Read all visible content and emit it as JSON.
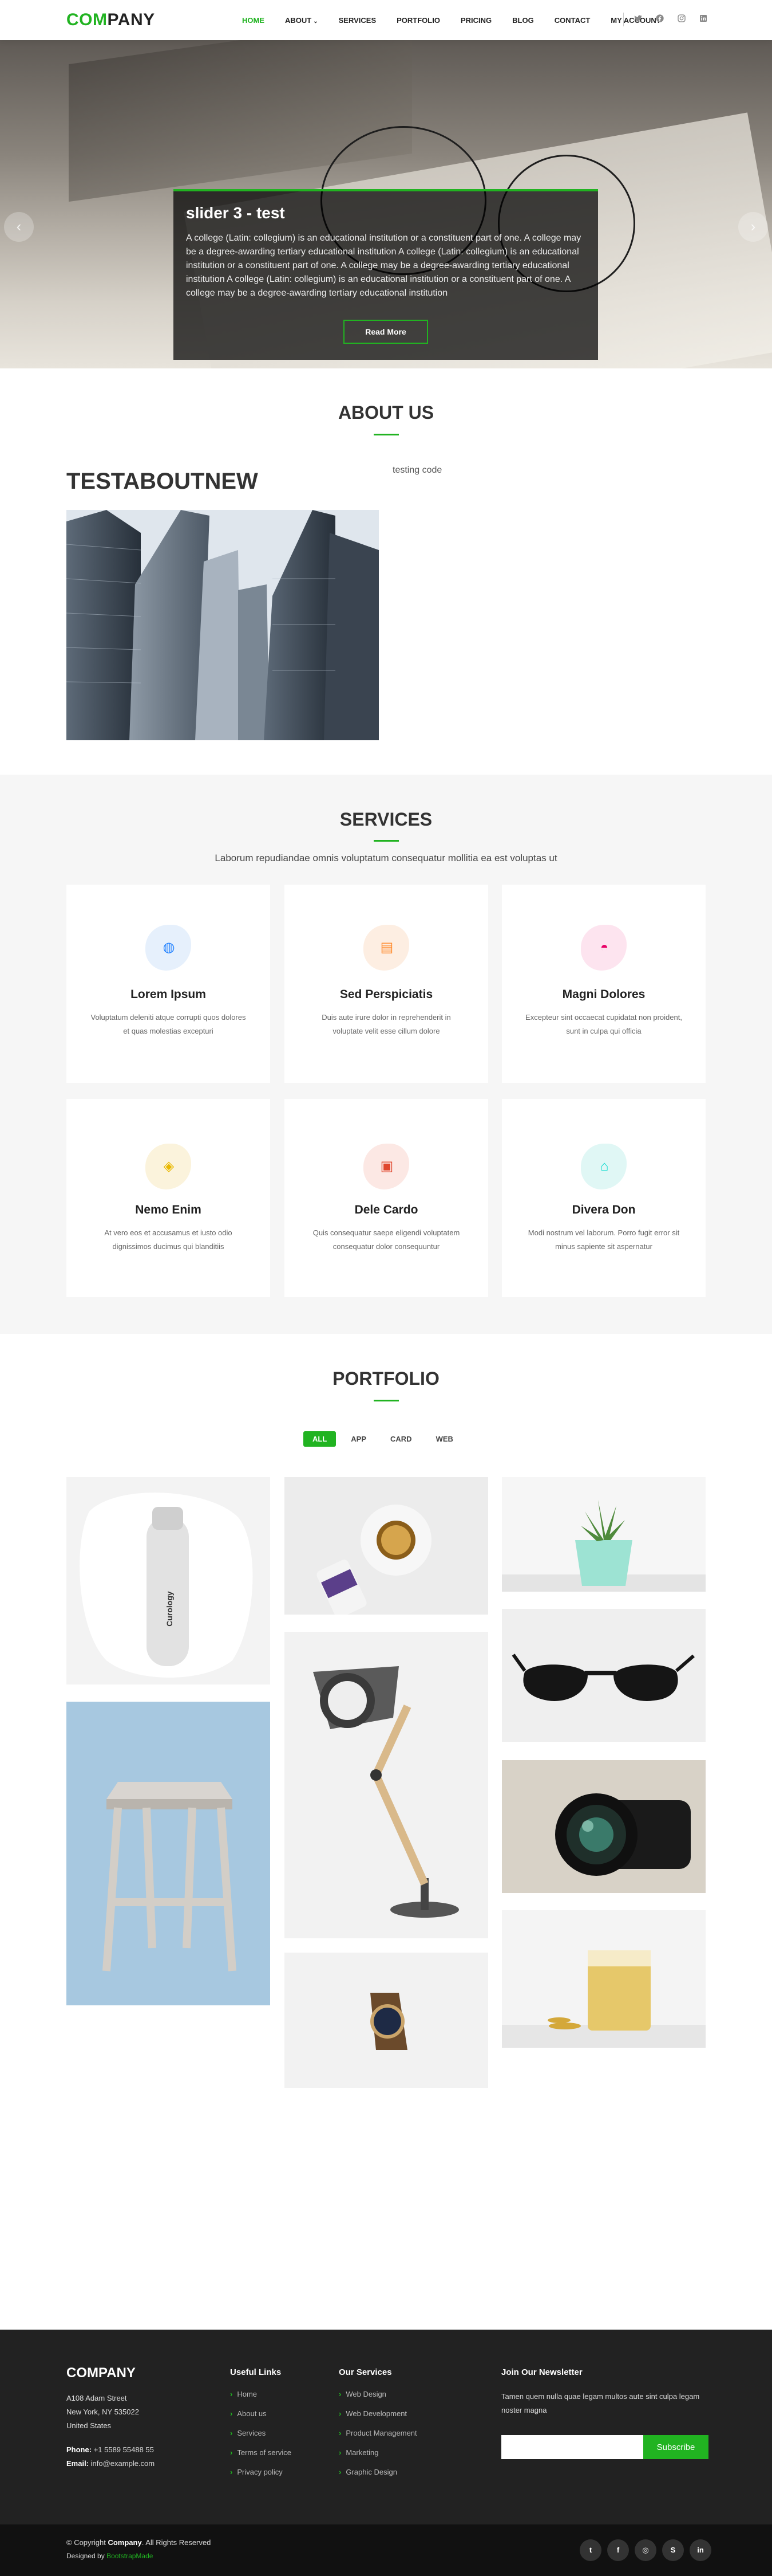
{
  "header": {
    "logo_prefix": "COM",
    "logo_suffix": "PANY",
    "nav": [
      {
        "label": "Home",
        "active": true
      },
      {
        "label": "About",
        "dropdown": true
      },
      {
        "label": "Services"
      },
      {
        "label": "Portfolio"
      },
      {
        "label": "Pricing"
      },
      {
        "label": "Blog"
      },
      {
        "label": "Contact"
      },
      {
        "label": "My Account"
      }
    ],
    "social": [
      "twitter-icon",
      "facebook-icon",
      "instagram-icon",
      "linkedin-icon"
    ]
  },
  "hero": {
    "title": "slider 3 - test",
    "text": "A college (Latin: collegium) is an educational institution or a constituent part of one. A college may be a degree-awarding tertiary educational institution A college (Latin: collegium) is an educational institution or a constituent part of one. A college may be a degree-awarding tertiary educational institution A college (Latin: collegium) is an educational institution or a constituent part of one. A college may be a degree-awarding tertiary educational institution",
    "button": "Read More",
    "slides": 3,
    "active_slide": 3
  },
  "about": {
    "section_title": "About Us",
    "heading": "TESTABOUTNEW",
    "text": "testing code"
  },
  "services": {
    "section_title": "Services",
    "subtitle": "Laborum repudiandae omnis voluptatum consequatur mollitia ea est voluptas ut",
    "items": [
      {
        "title": "Lorem Ipsum",
        "text": "Voluptatum deleniti atque corrupti quos dolores et quas molestias excepturi",
        "icon": "dribbble-icon",
        "color": "#2282ff",
        "blob": "#e6f0fc"
      },
      {
        "title": "Sed Perspiciatis",
        "text": "Duis aute irure dolor in reprehenderit in voluptate velit esse cillum dolore",
        "icon": "file-icon",
        "color": "#ff8a2b",
        "blob": "#fdeee2"
      },
      {
        "title": "Magni Dolores",
        "text": "Excepteur sint occaecat cupidatat non proident, sunt in culpa qui officia",
        "icon": "tachometer-icon",
        "color": "#e80368",
        "blob": "#fde4ef"
      },
      {
        "title": "Nemo Enim",
        "text": "At vero eos et accusamus et iusto odio dignissimos ducimus qui blanditiis",
        "icon": "layers-icon",
        "color": "#e9b800",
        "blob": "#fbf3dc"
      },
      {
        "title": "Dele Cardo",
        "text": "Quis consequatur saepe eligendi voluptatem consequatur dolor consequuntur",
        "icon": "slideshow-icon",
        "color": "#e0472e",
        "blob": "#fce8e4"
      },
      {
        "title": "Divera Don",
        "text": "Modi nostrum vel laborum. Porro fugit error sit minus sapiente sit aspernatur",
        "icon": "arch-icon",
        "color": "#11dbcf",
        "blob": "#e0f7f5"
      }
    ]
  },
  "portfolio": {
    "section_title": "Portfolio",
    "filters": [
      {
        "label": "All",
        "active": true
      },
      {
        "label": "App"
      },
      {
        "label": "Card"
      },
      {
        "label": "Web"
      }
    ],
    "items": [
      {
        "name": "cream-bottle",
        "product_text": "Curology"
      },
      {
        "name": "coffee-and-pencils"
      },
      {
        "name": "succulent-pot"
      },
      {
        "name": "desk-lamp"
      },
      {
        "name": "sunglasses"
      },
      {
        "name": "wooden-stool"
      },
      {
        "name": "camera-lens"
      },
      {
        "name": "wrist-watch"
      },
      {
        "name": "drink-glass"
      }
    ]
  },
  "footer": {
    "company": "COMPANY",
    "address": [
      "A108 Adam Street",
      "New York, NY 535022",
      "United States"
    ],
    "phone_label": "Phone:",
    "phone": "+1 5589 55488 55",
    "email_label": "Email:",
    "email": "info@example.com",
    "useful_links_title": "Useful Links",
    "useful_links": [
      "Home",
      "About us",
      "Services",
      "Terms of service",
      "Privacy policy"
    ],
    "our_services_title": "Our Services",
    "our_services": [
      "Web Design",
      "Web Development",
      "Product Management",
      "Marketing",
      "Graphic Design"
    ],
    "newsletter_title": "Join Our Newsletter",
    "newsletter_text": "Tamen quem nulla quae legam multos aute sint culpa legam noster magna",
    "newsletter_button": "Subscribe",
    "copyright_prefix": "© Copyright",
    "copyright_brand": "Company",
    "copyright_suffix": ". All Rights Reserved",
    "designed_by_label": "Designed by",
    "designed_by": "BootstrapMade",
    "social": [
      {
        "icon": "twitter-icon",
        "glyph": "t"
      },
      {
        "icon": "facebook-icon",
        "glyph": "f"
      },
      {
        "icon": "instagram-icon",
        "glyph": "◎"
      },
      {
        "icon": "skype-icon",
        "glyph": "S"
      },
      {
        "icon": "linkedin-icon",
        "glyph": "in"
      }
    ]
  },
  "colors": {
    "accent": "#21b321",
    "dark": "#222222"
  }
}
